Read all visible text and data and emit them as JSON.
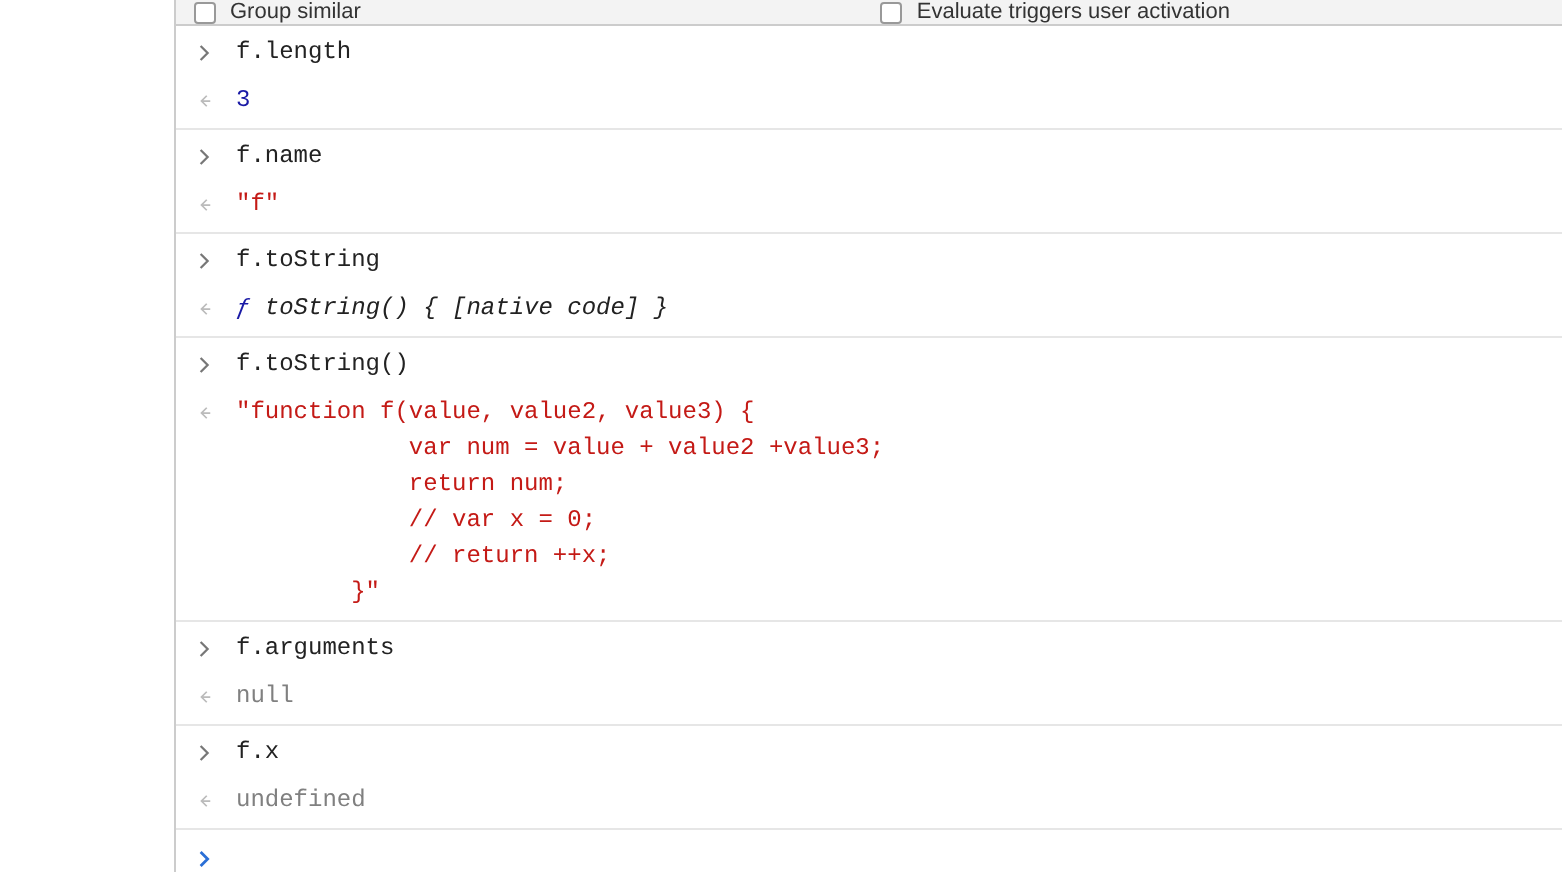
{
  "toolbar": {
    "options": [
      {
        "label": "Group similar",
        "checked": false
      },
      {
        "label": "Evaluate triggers user activation",
        "checked": false
      }
    ]
  },
  "entries": [
    {
      "input": "f.length",
      "result": {
        "kind": "number",
        "text": "3"
      }
    },
    {
      "input": "f.name",
      "result": {
        "kind": "string",
        "text": "\"f\""
      }
    },
    {
      "input": "f.toString",
      "result": {
        "kind": "function",
        "prefix": "ƒ",
        "text": "toString() { [native code] }"
      }
    },
    {
      "input": "f.toString()",
      "result": {
        "kind": "string",
        "text": "\"function f(value, value2, value3) {\n            var num = value + value2 +value3;\n            return num;\n            // var x = 0;\n            // return ++x;\n        }\""
      }
    },
    {
      "input": "f.arguments",
      "result": {
        "kind": "null",
        "text": "null"
      }
    },
    {
      "input": "f.x",
      "result": {
        "kind": "null",
        "text": "undefined"
      }
    }
  ]
}
